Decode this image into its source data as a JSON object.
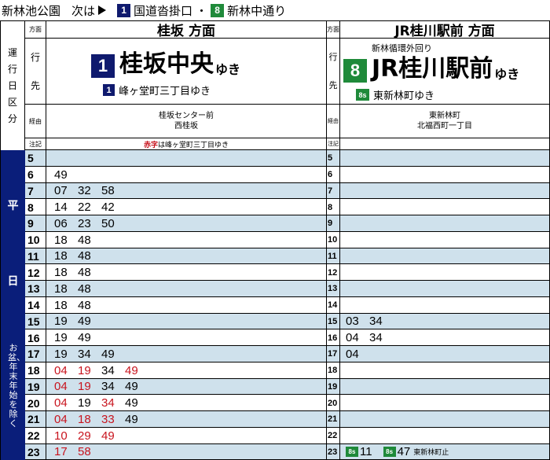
{
  "top": {
    "stop": "新林池公園",
    "next_label": "次は",
    "next1_badge": "1",
    "next1_name": "国道沓掛口",
    "sep": "・",
    "next2_badge": "8",
    "next2_name": "新林中通り"
  },
  "labels": {
    "col_chars": [
      "運",
      "行",
      "日",
      "区",
      "分"
    ],
    "houmen": "方面",
    "yukisaki_1": "行",
    "yukisaki_2": "先",
    "keiyu": "経由",
    "chuki": "注記",
    "day_chars": [
      "平",
      "日"
    ],
    "day_note": "お盆、年末年始を除く"
  },
  "left": {
    "direction": "桂坂 方面",
    "badge": "1",
    "dest": "桂坂中央",
    "yuki": "ゆき",
    "sub_badge": "1",
    "sub_dest": "峰ヶ堂町三丁目ゆき",
    "via_1": "桂坂センター前",
    "via_2": "西桂坂",
    "note_red": "赤字",
    "note_rest": "は峰ヶ堂町三丁目ゆき"
  },
  "right": {
    "direction": "JR桂川駅前 方面",
    "pre_line": "新林循環外回り",
    "badge": "8",
    "dest": "JR桂川駅前",
    "yuki": "ゆき",
    "sub_badge": "8s",
    "sub_dest": "東新林町ゆき",
    "via_1": "東新林町",
    "via_2": "北福西町一丁目"
  },
  "colors": {
    "navy": "#0f1a6e",
    "green": "#1f8a3a",
    "red": "#c8141e",
    "shade": "#cfe1ec"
  },
  "timetable": [
    {
      "hour": "5",
      "left": [],
      "right": []
    },
    {
      "hour": "6",
      "left": [
        [
          "49",
          ""
        ]
      ],
      "right": []
    },
    {
      "hour": "7",
      "left": [
        [
          "07",
          ""
        ],
        [
          "32",
          ""
        ],
        [
          "58",
          ""
        ]
      ],
      "right": []
    },
    {
      "hour": "8",
      "left": [
        [
          "14",
          ""
        ],
        [
          "22",
          ""
        ],
        [
          "42",
          ""
        ]
      ],
      "right": []
    },
    {
      "hour": "9",
      "left": [
        [
          "06",
          ""
        ],
        [
          "23",
          ""
        ],
        [
          "50",
          ""
        ]
      ],
      "right": []
    },
    {
      "hour": "10",
      "left": [
        [
          "18",
          ""
        ],
        [
          "48",
          ""
        ]
      ],
      "right": []
    },
    {
      "hour": "11",
      "left": [
        [
          "18",
          ""
        ],
        [
          "48",
          ""
        ]
      ],
      "right": []
    },
    {
      "hour": "12",
      "left": [
        [
          "18",
          ""
        ],
        [
          "48",
          ""
        ]
      ],
      "right": []
    },
    {
      "hour": "13",
      "left": [
        [
          "18",
          ""
        ],
        [
          "48",
          ""
        ]
      ],
      "right": []
    },
    {
      "hour": "14",
      "left": [
        [
          "18",
          ""
        ],
        [
          "48",
          ""
        ]
      ],
      "right": []
    },
    {
      "hour": "15",
      "left": [
        [
          "19",
          ""
        ],
        [
          "49",
          ""
        ]
      ],
      "right": [
        [
          "03",
          ""
        ],
        [
          "34",
          ""
        ]
      ]
    },
    {
      "hour": "16",
      "left": [
        [
          "19",
          ""
        ],
        [
          "49",
          ""
        ]
      ],
      "right": [
        [
          "04",
          ""
        ],
        [
          "34",
          ""
        ]
      ]
    },
    {
      "hour": "17",
      "left": [
        [
          "19",
          ""
        ],
        [
          "34",
          ""
        ],
        [
          "49",
          ""
        ]
      ],
      "right": [
        [
          "04",
          ""
        ]
      ]
    },
    {
      "hour": "18",
      "left": [
        [
          "04",
          "red"
        ],
        [
          "19",
          "red"
        ],
        [
          "34",
          ""
        ],
        [
          "49",
          "red"
        ]
      ],
      "right": []
    },
    {
      "hour": "19",
      "left": [
        [
          "04",
          "red"
        ],
        [
          "19",
          "red"
        ],
        [
          "34",
          ""
        ],
        [
          "49",
          ""
        ]
      ],
      "right": []
    },
    {
      "hour": "20",
      "left": [
        [
          "04",
          "red"
        ],
        [
          "19",
          ""
        ],
        [
          "34",
          "red"
        ],
        [
          "49",
          ""
        ]
      ],
      "right": []
    },
    {
      "hour": "21",
      "left": [
        [
          "04",
          "red"
        ],
        [
          "18",
          "red"
        ],
        [
          "33",
          "red"
        ],
        [
          "49",
          ""
        ]
      ],
      "right": []
    },
    {
      "hour": "22",
      "left": [
        [
          "10",
          "red"
        ],
        [
          "29",
          "red"
        ],
        [
          "49",
          "red"
        ]
      ],
      "right": []
    },
    {
      "hour": "23",
      "left": [
        [
          "17",
          "red"
        ],
        [
          "58",
          "red"
        ]
      ],
      "right": [
        [
          "11",
          "8s"
        ],
        [
          "47",
          "8s"
        ]
      ]
    }
  ],
  "last_note": "東新林町止"
}
